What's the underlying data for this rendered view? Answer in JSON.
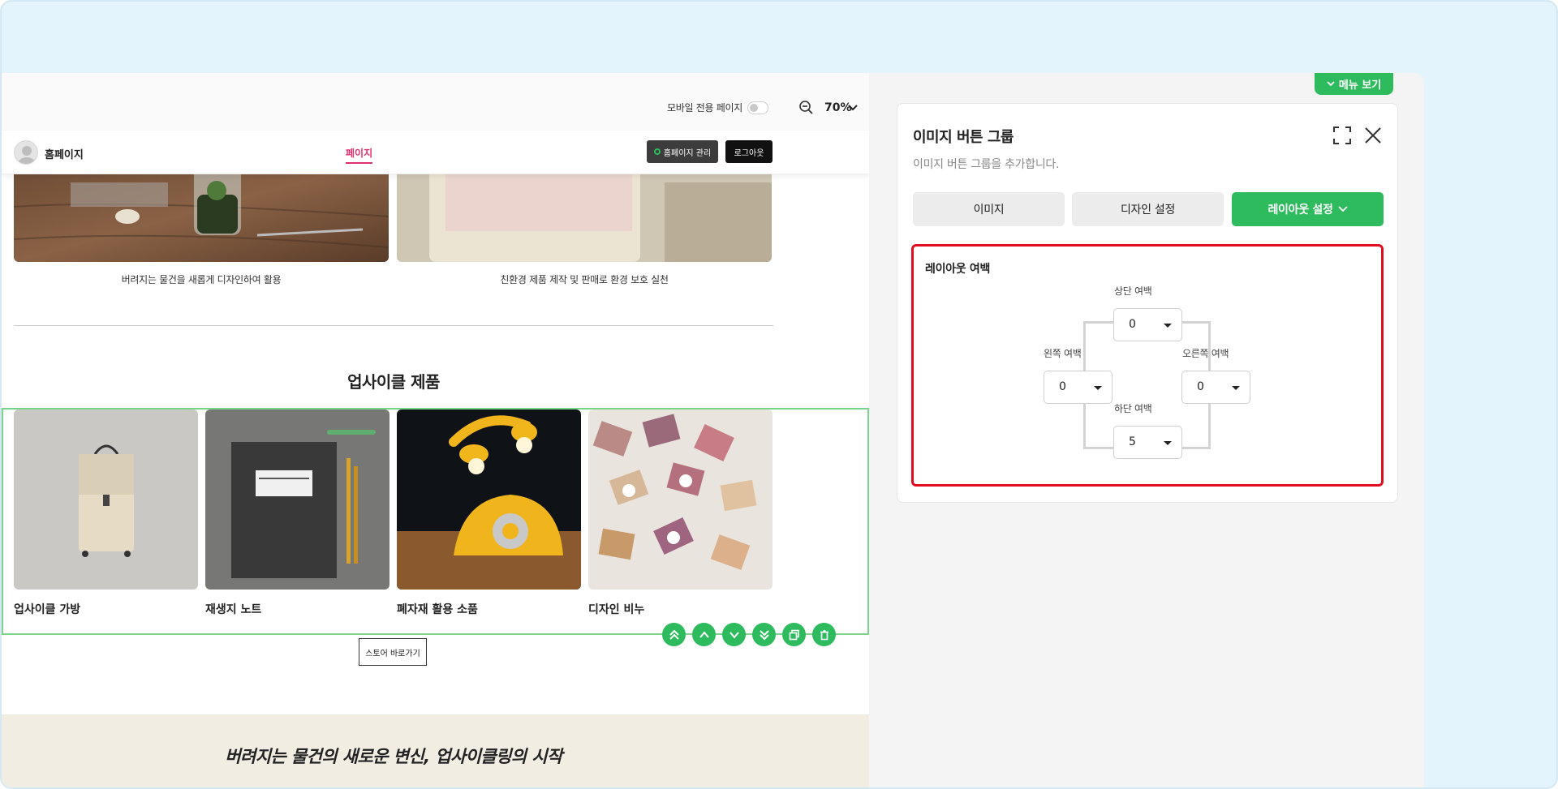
{
  "toolbar": {
    "mobile_only_label": "모바일 전용 페이지",
    "zoom_value": "70%"
  },
  "site_nav": {
    "brand": "홈페이지",
    "page_link": "페이지",
    "manage_button": "홈페이지 관리",
    "logout_button": "로그아웃"
  },
  "gallery": {
    "captions": [
      "버려지는 물건을 새롭게 디자인하여 활용",
      "친환경 제품 제작 및 판매로 환경 보호 실천"
    ]
  },
  "products": {
    "title": "업사이클 제품",
    "items": [
      {
        "label": "업사이클 가방"
      },
      {
        "label": "재생지 노트"
      },
      {
        "label": "폐자재 활용 소품"
      },
      {
        "label": "디자인 비누"
      }
    ],
    "store_button": "스토어 바로가기"
  },
  "footer": {
    "slogan": "버려지는 물건의 새로운 변신, 업사이클링의 시작"
  },
  "panel": {
    "menu_toggle": "메뉴 보기",
    "title": "이미지 버튼 그룹",
    "description": "이미지 버튼 그룹을 추가합니다.",
    "tabs": [
      "이미지",
      "디자인 설정",
      "레이아웃 설정"
    ],
    "layout_margin": {
      "title": "레이아웃 여백",
      "top_label": "상단 여백",
      "top_value": "0",
      "left_label": "왼쪽 여백",
      "left_value": "0",
      "right_label": "오른쪽 여백",
      "right_value": "0",
      "bottom_label": "하단 여백",
      "bottom_value": "5"
    }
  },
  "colors": {
    "accent_green": "#2dbb5d",
    "highlight_red": "#e00d1f",
    "active_nav_pink": "#e0306f"
  }
}
